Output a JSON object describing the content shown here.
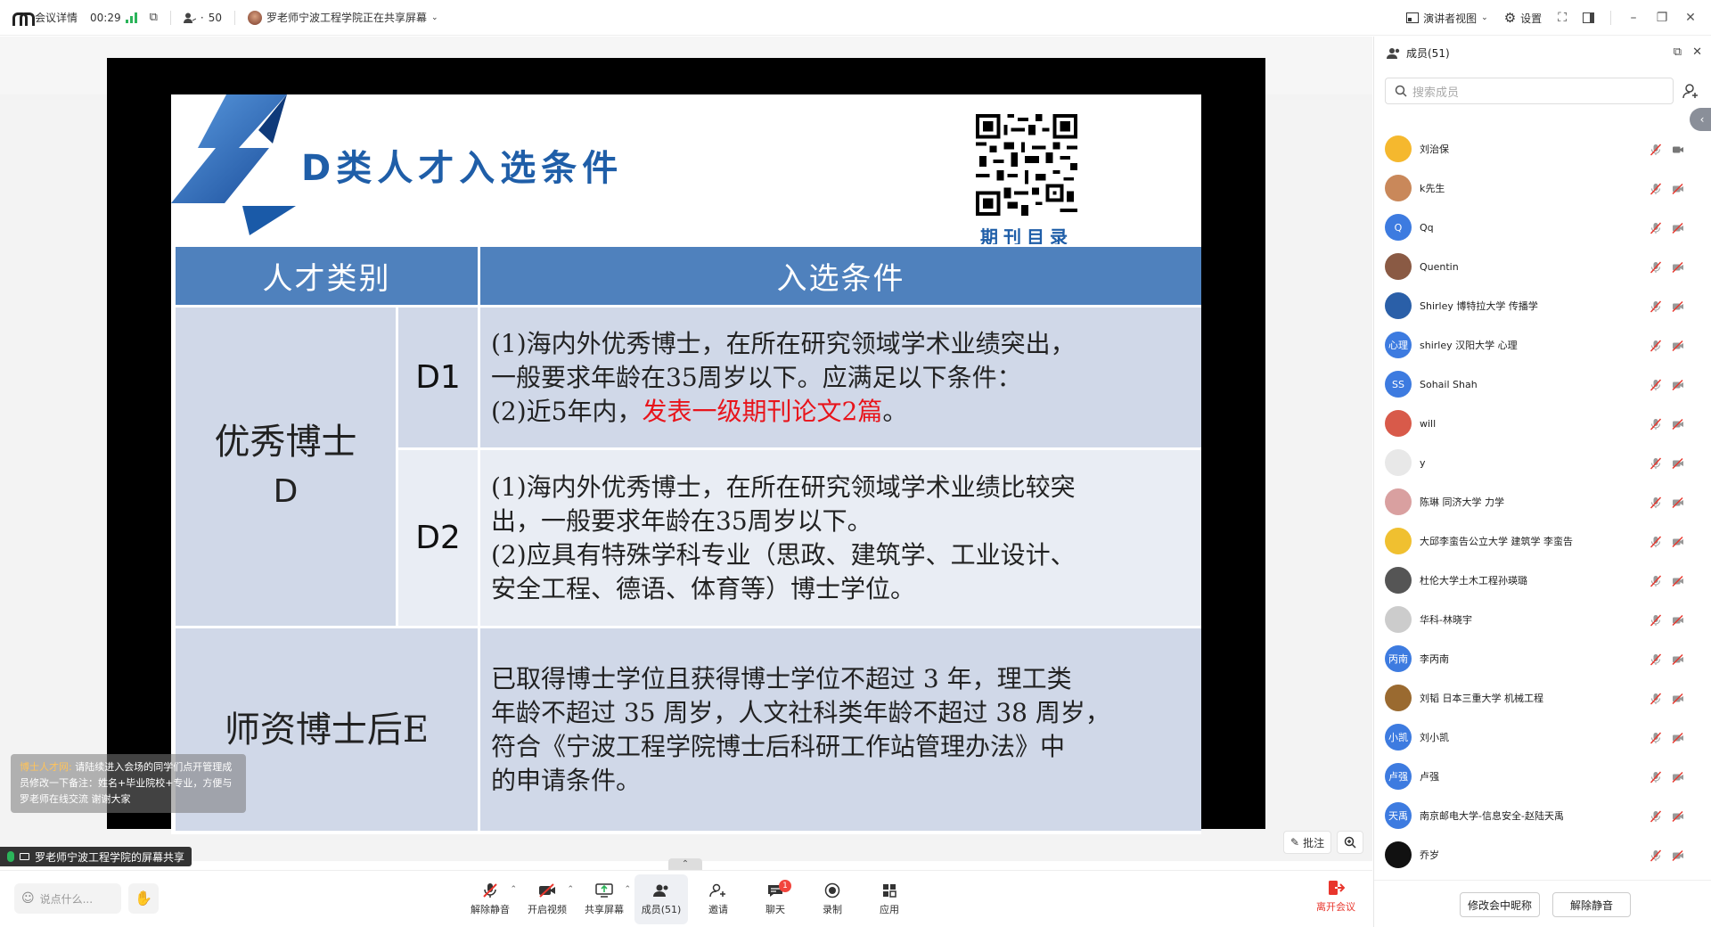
{
  "topbar": {
    "meeting_details": "会议详情",
    "elapsed": "00:29",
    "participants": "50",
    "sharing_status": "罗老师宁波工程学院正在共享屏幕",
    "speaker_view": "演讲者视图",
    "settings": "设置"
  },
  "slide": {
    "title": "D类人才入选条件",
    "qr_label": "期刊目录",
    "header_category": "人才类别",
    "header_criteria": "入选条件",
    "row1_category": "优秀博士",
    "row1_category_code": "D",
    "d1_code": "D1",
    "d1_line1": "(1)海内外优秀博士，在所在研究领域学术业绩突出，",
    "d1_line2": "一般要求年龄在35周岁以下。应满足以下条件：",
    "d1_line3_prefix": "(2)近5年内，",
    "d1_line3_highlight": "发表一级期刊论文2篇",
    "d1_line3_suffix": "。",
    "d2_code": "D2",
    "d2_line1": "(1)海内外优秀博士，在所在研究领域学术业绩比较突",
    "d2_line2": "出，一般要求年龄在35周岁以下。",
    "d2_line3": "(2)应具有特殊学科专业（思政、建筑学、工业设计、",
    "d2_line4": "安全工程、德语、体育等）博士学位。",
    "row2_category": "师资博士后E",
    "e_line1": "已取得博士学位且获得博士学位不超过 3 年，理工类",
    "e_line2": "年龄不超过 35 周岁，人文社科类年龄不超过 38 周岁，",
    "e_line3": "符合《宁波工程学院博士后科研工作站管理办法》中",
    "e_line4": "的申请条件。"
  },
  "overlay": {
    "chat_sender": "博士人才网:",
    "chat_message": " 请陆续进入会场的同学们点开管理成员修改一下备注：姓名+毕业院校+专业，方便与罗老师在线交流 谢谢大家",
    "share_label": "罗老师宁波工程学院的屏幕共享",
    "annotate": "批注"
  },
  "toolbar": {
    "chat_placeholder": "说点什么...",
    "unmute": "解除静音",
    "start_video": "开启视频",
    "share_screen": "共享屏幕",
    "members": "成员(51)",
    "invite": "邀请",
    "chat": "聊天",
    "chat_badge": "1",
    "record": "录制",
    "apps": "应用",
    "leave": "离开会议"
  },
  "panel": {
    "title": "成员(51)",
    "search_placeholder": "搜索成员",
    "members": [
      {
        "name": "刘治保",
        "avatar_text": "",
        "avatar_color": "#f5b82e",
        "video_on": true
      },
      {
        "name": "k先生",
        "avatar_text": "",
        "avatar_color": "#c9885a",
        "video_on": false
      },
      {
        "name": "Qq",
        "avatar_text": "Q",
        "avatar_color": "#3d7be0",
        "video_on": false
      },
      {
        "name": "Quentin",
        "avatar_text": "",
        "avatar_color": "#8a5a44",
        "video_on": false
      },
      {
        "name": "Shirley 博特拉大学 传播学",
        "avatar_text": "",
        "avatar_color": "#2a5fa8",
        "video_on": false
      },
      {
        "name": "shirley 汉阳大学 心理",
        "avatar_text": "心理",
        "avatar_color": "#3d7be0",
        "video_on": false
      },
      {
        "name": "Sohail Shah",
        "avatar_text": "SS",
        "avatar_color": "#3d7be0",
        "video_on": false
      },
      {
        "name": "will",
        "avatar_text": "",
        "avatar_color": "#d85a4a",
        "video_on": false
      },
      {
        "name": "y",
        "avatar_text": "",
        "avatar_color": "#e8e8e8",
        "video_on": false
      },
      {
        "name": "陈琳 同济大学 力学",
        "avatar_text": "",
        "avatar_color": "#d9a0a0",
        "video_on": false
      },
      {
        "name": "大邱李蛮告公立大学 建筑学 李蛮告",
        "avatar_text": "",
        "avatar_color": "#f0c030",
        "video_on": false
      },
      {
        "name": "杜伦大学土木工程孙瑛璐",
        "avatar_text": "",
        "avatar_color": "#555555",
        "video_on": false
      },
      {
        "name": "华科-林晓宇",
        "avatar_text": "",
        "avatar_color": "#cccccc",
        "video_on": false
      },
      {
        "name": "李丙南",
        "avatar_text": "丙南",
        "avatar_color": "#3d7be0",
        "video_on": false
      },
      {
        "name": "刘韬 日本三重大学 机械工程",
        "avatar_text": "",
        "avatar_color": "#9a6a30",
        "video_on": false
      },
      {
        "name": "刘小凯",
        "avatar_text": "小凯",
        "avatar_color": "#3d7be0",
        "video_on": false
      },
      {
        "name": "卢强",
        "avatar_text": "卢强",
        "avatar_color": "#3d7be0",
        "video_on": false
      },
      {
        "name": "南京邮电大学-信息安全-赵陆天禹",
        "avatar_text": "天禹",
        "avatar_color": "#3d7be0",
        "video_on": false
      },
      {
        "name": "乔岁",
        "avatar_text": "",
        "avatar_color": "#111111",
        "video_on": false
      }
    ],
    "rename_button": "修改会中昵称",
    "unmute_button": "解除静音"
  }
}
